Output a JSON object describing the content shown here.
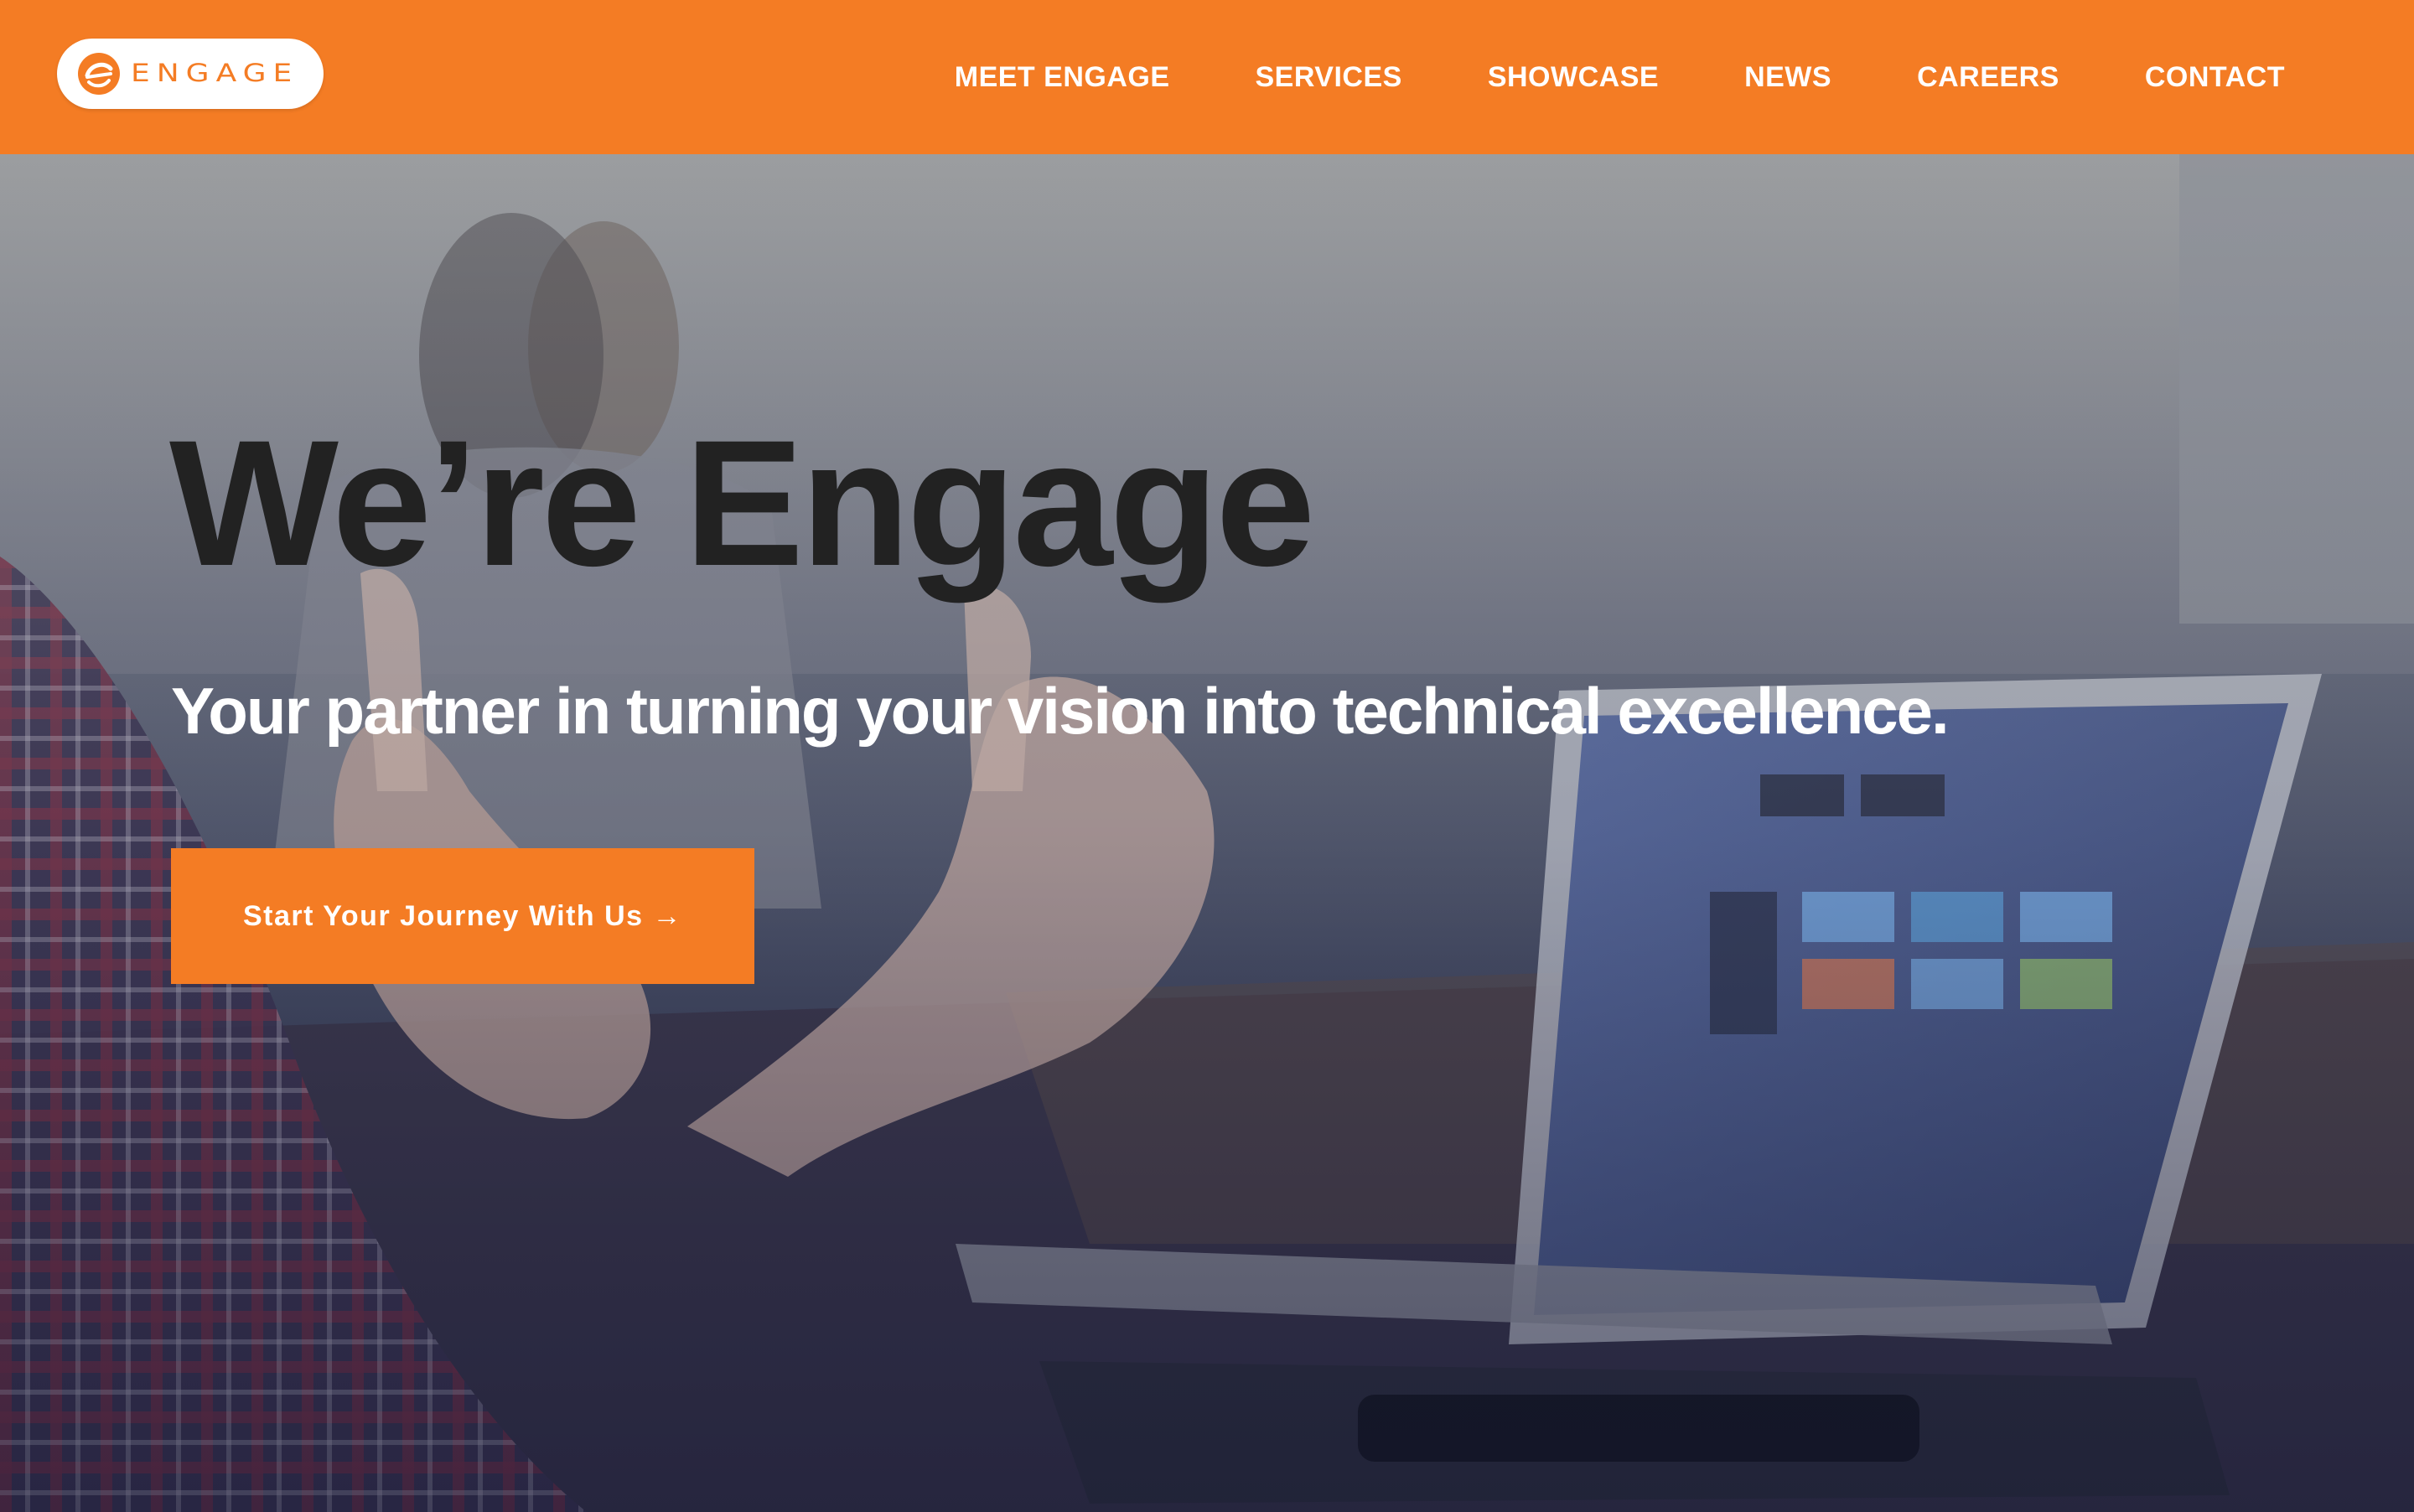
{
  "brand": {
    "name": "ENGAGE",
    "logo_icon": "engage-circle-logo",
    "accent_color": "#f47c24"
  },
  "nav": {
    "items": [
      {
        "label": "MEET ENGAGE"
      },
      {
        "label": "SERVICES"
      },
      {
        "label": "SHOWCASE"
      },
      {
        "label": "NEWS"
      },
      {
        "label": "CAREERS"
      },
      {
        "label": "CONTACT"
      }
    ]
  },
  "hero": {
    "title": "We’re Engage",
    "subtitle": "Your partner in turning your vision into technical excellence.",
    "cta_label": "Start Your Journey With Us →",
    "background_image": "people-meeting-with-laptop-photo"
  }
}
